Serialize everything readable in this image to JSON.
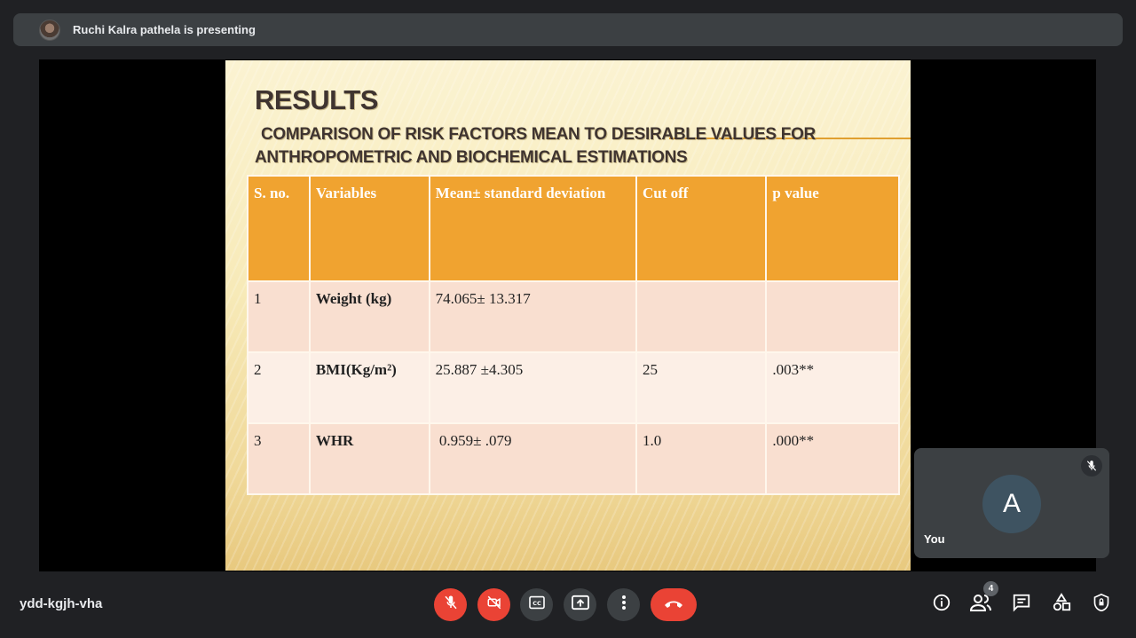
{
  "presenter": {
    "text": "Ruchi Kalra pathela is presenting"
  },
  "slide": {
    "title": "RESULTS",
    "subtitle_line1": "COMPARISON OF RISK FACTORS MEAN TO DESIRABLE VALUES FOR",
    "subtitle_line2": "ANTHROPOMETRIC AND BIOCHEMICAL ESTIMATIONS",
    "table": {
      "headers": [
        "S. no.",
        "Variables",
        "Mean± standard deviation",
        "Cut off",
        "p value"
      ],
      "rows": [
        [
          "1",
          "Weight (kg)",
          "74.065± 13.317",
          "",
          ""
        ],
        [
          "2",
          "BMI(Kg/m²)",
          "25.887 ±4.305",
          "25",
          ".003**"
        ],
        [
          "3",
          "WHR",
          " 0.959± .079",
          "1.0",
          ".000**"
        ]
      ]
    }
  },
  "self_tile": {
    "avatar_letter": "A",
    "name": "You",
    "mic_icon": "mic-off-icon"
  },
  "meeting": {
    "code": "ydd-kgjh-vha"
  },
  "participants": {
    "count": "4"
  },
  "colors": {
    "background": "#202124",
    "danger": "#ea4335",
    "header_orange": "#f0a330"
  }
}
